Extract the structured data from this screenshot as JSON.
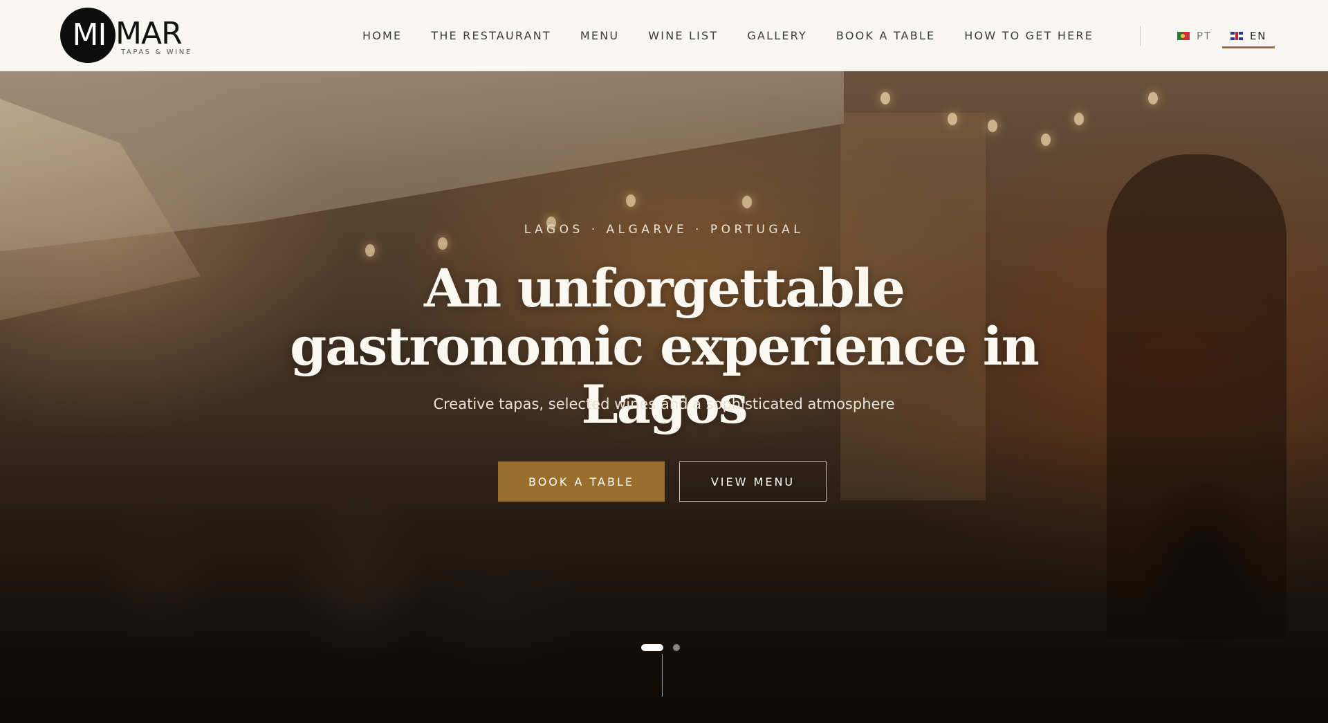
{
  "brand": {
    "logo_mark": "MI",
    "logo_word": "MAR",
    "tagline": "TAPAS & WINE"
  },
  "nav": {
    "items": [
      {
        "label": "HOME"
      },
      {
        "label": "THE RESTAURANT"
      },
      {
        "label": "MENU"
      },
      {
        "label": "WINE LIST"
      },
      {
        "label": "GALLERY"
      },
      {
        "label": "BOOK A TABLE"
      },
      {
        "label": "HOW TO GET HERE"
      }
    ]
  },
  "languages": {
    "pt": {
      "label": "PT",
      "icon": "portugal-flag-icon"
    },
    "en": {
      "label": "EN",
      "icon": "uk-flag-icon",
      "active": true
    }
  },
  "hero": {
    "kicker": "LAGOS · ALGARVE · PORTUGAL",
    "headline": "An unforgettable gastronomic experience in Lagos",
    "subline": "Creative tapas, selected wines and a sophisticated atmosphere",
    "primary_button": "BOOK A TABLE",
    "secondary_button": "VIEW MENU",
    "slider": {
      "total_slides": 2,
      "active_slide": 1
    }
  },
  "colors": {
    "accent": "#9a6e2c",
    "header_bg": "#f8f7f3",
    "nav_text": "#3a3a3a"
  }
}
